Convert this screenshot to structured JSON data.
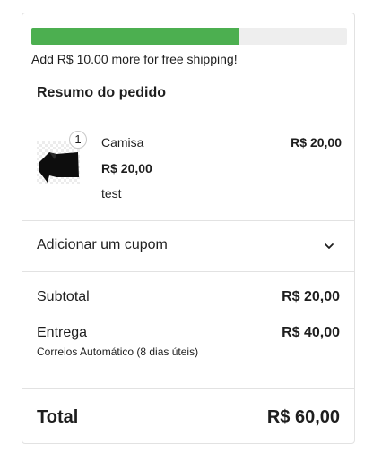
{
  "shipping": {
    "progress_percent": 66,
    "message": "Add R$ 10.00 more for free shipping!",
    "bar_color": "#4caf50"
  },
  "summary": {
    "title": "Resumo do pedido"
  },
  "cart": {
    "items": [
      {
        "quantity": "1",
        "name": "Camisa",
        "unit_price": "R$ 20,00",
        "variant": "test",
        "line_total": "R$ 20,00",
        "thumbnail_icon": "shirt-thumbnail"
      }
    ]
  },
  "coupon": {
    "label": "Adicionar um cupom",
    "icon": "chevron-down-icon"
  },
  "totals": {
    "subtotal_label": "Subtotal",
    "subtotal_value": "R$ 20,00",
    "shipping_label": "Entrega",
    "shipping_value": "R$ 40,00",
    "shipping_method": "Correios Automático (8 dias úteis)",
    "total_label": "Total",
    "total_value": "R$ 60,00"
  }
}
